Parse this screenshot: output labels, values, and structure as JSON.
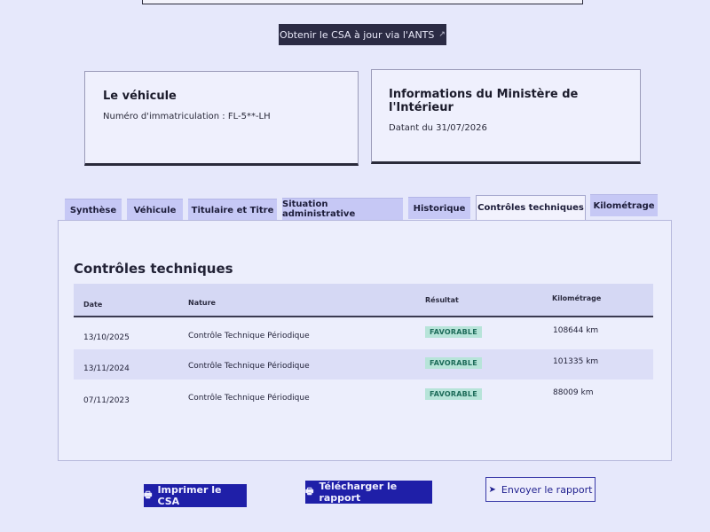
{
  "ants_button": {
    "label": "Obtenir le CSA à jour via l'ANTS",
    "icon": "external-link-icon"
  },
  "vehicle_card": {
    "title": "Le véhicule",
    "registration": "Numéro d'immatriculation : FL-5**-LH"
  },
  "ministry_card": {
    "title": "Informations du Ministère de l'Intérieur",
    "date": "Datant du 31/07/2026"
  },
  "tabs": [
    {
      "label": "Synthèse"
    },
    {
      "label": "Véhicule"
    },
    {
      "label": "Titulaire et Titre"
    },
    {
      "label": "Situation administrative"
    },
    {
      "label": "Historique"
    },
    {
      "label": "Contrôles techniques",
      "active": true
    },
    {
      "label": "Kilométrage"
    }
  ],
  "panel": {
    "title": "Contrôles techniques",
    "headers": {
      "date": "Date",
      "nature": "Nature",
      "result": "Résultat",
      "mileage": "Kilométrage"
    },
    "rows": [
      {
        "date": "13/10/2025",
        "nature": "Contrôle Technique Périodique",
        "result": "FAVORABLE",
        "mileage": "108644 km"
      },
      {
        "date": "13/11/2024",
        "nature": "Contrôle Technique Périodique",
        "result": "FAVORABLE",
        "mileage": "101335 km"
      },
      {
        "date": "07/11/2023",
        "nature": "Contrôle Technique Périodique",
        "result": "FAVORABLE",
        "mileage": "88009 km"
      }
    ]
  },
  "actions": {
    "print_label": "Imprimer le CSA",
    "download_label": "Télécharger le rapport",
    "send_label": "Envoyer le rapport"
  },
  "colors": {
    "primary": "#1f1fa8",
    "badge_bg": "#b7e4d9",
    "badge_text": "#1e6c5a"
  }
}
